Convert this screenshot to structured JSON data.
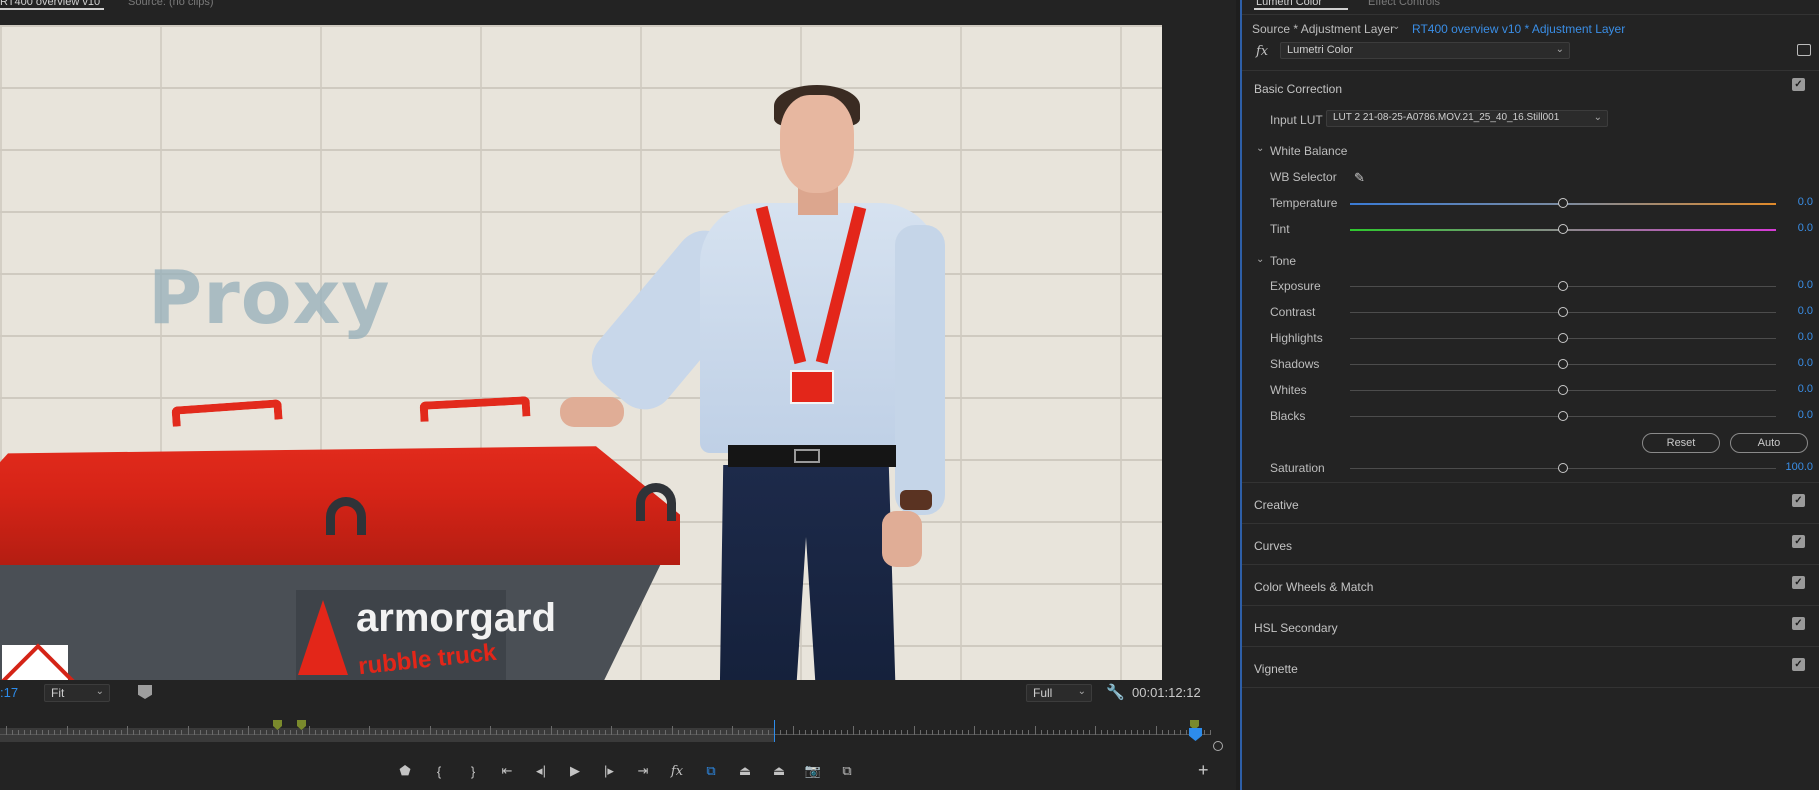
{
  "monitor": {
    "tab_program": "RT400 overview v10",
    "tab_source": "Source: (no clips)",
    "overlay_text": "Proxy",
    "timecode_left": ":17",
    "zoom": "Fit",
    "resolution": "Full",
    "timecode_right": "00:01:12:12",
    "video": {
      "truck_brand": "armorgard",
      "truck_model": "rubble truck"
    },
    "transport": [
      {
        "name": "add-marker",
        "icon": "marker-icon",
        "glyph": "⬟"
      },
      {
        "name": "mark-in",
        "icon": "mark-in-icon",
        "glyph": "{"
      },
      {
        "name": "mark-out",
        "icon": "mark-out-icon",
        "glyph": "}"
      },
      {
        "name": "go-to-in",
        "icon": "go-to-in-icon",
        "glyph": "⇤"
      },
      {
        "name": "step-back",
        "icon": "step-back-icon",
        "glyph": "◂|"
      },
      {
        "name": "play",
        "icon": "play-icon",
        "glyph": "▶"
      },
      {
        "name": "step-forward",
        "icon": "step-forward-icon",
        "glyph": "|▸"
      },
      {
        "name": "go-to-out",
        "icon": "go-to-out-icon",
        "glyph": "⇥"
      },
      {
        "name": "fx",
        "icon": "fx-icon",
        "glyph": "fx"
      },
      {
        "name": "proxy-toggle",
        "icon": "proxy-toggle-icon",
        "glyph": "⧉",
        "active": true
      },
      {
        "name": "lift",
        "icon": "lift-icon",
        "glyph": "⏏"
      },
      {
        "name": "extract",
        "icon": "extract-icon",
        "glyph": "⏏"
      },
      {
        "name": "export-frame",
        "icon": "camera-icon",
        "glyph": "📷"
      },
      {
        "name": "comparison-view",
        "icon": "comparison-view-icon",
        "glyph": "⧉"
      }
    ]
  },
  "lumetri": {
    "tab_lumetri": "Lumetri Color",
    "tab_effects": "Effect Controls",
    "source_label": "Source * Adjustment Layer",
    "clip_label": "RT400 overview v10 * Adjustment Layer",
    "fx_effect": "Lumetri Color",
    "basic_correction": {
      "title": "Basic Correction",
      "input_lut_label": "Input LUT",
      "input_lut_value": "LUT 2 21-08-25-A0786.MOV.21_25_40_16.Still001",
      "white_balance_title": "White Balance",
      "wb_selector_label": "WB Selector",
      "sliders_wb": [
        {
          "label": "Temperature",
          "value": "0.0",
          "fraction": 0.5
        },
        {
          "label": "Tint",
          "value": "0.0",
          "fraction": 0.5
        }
      ],
      "tone_title": "Tone",
      "sliders_tone": [
        {
          "label": "Exposure",
          "value": "0.0",
          "fraction": 0.5
        },
        {
          "label": "Contrast",
          "value": "0.0",
          "fraction": 0.5
        },
        {
          "label": "Highlights",
          "value": "0.0",
          "fraction": 0.5
        },
        {
          "label": "Shadows",
          "value": "0.0",
          "fraction": 0.5
        },
        {
          "label": "Whites",
          "value": "0.0",
          "fraction": 0.5
        },
        {
          "label": "Blacks",
          "value": "0.0",
          "fraction": 0.5
        }
      ],
      "reset_label": "Reset",
      "auto_label": "Auto",
      "saturation": {
        "label": "Saturation",
        "value": "100.0",
        "fraction": 0.5
      }
    },
    "sections": [
      "Creative",
      "Curves",
      "Color Wheels & Match",
      "HSL Secondary",
      "Vignette"
    ]
  },
  "colors": {
    "accent": "#2d8ceb",
    "link": "#3a8ee6",
    "panel": "#232323",
    "temperature_left": "#3a7bd5",
    "temperature_right": "#e08a2a",
    "tint_left": "#2ec82e",
    "tint_right": "#d63ad6"
  }
}
